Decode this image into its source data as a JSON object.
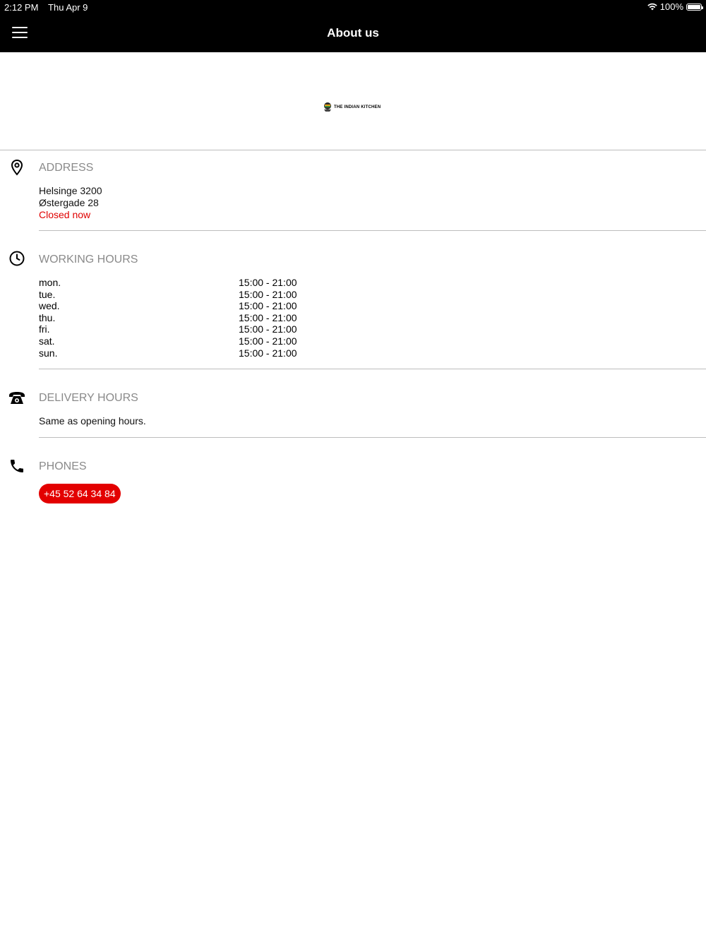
{
  "status_bar": {
    "time": "2:12 PM",
    "date": "Thu Apr 9",
    "battery": "100%"
  },
  "header": {
    "title": "About us"
  },
  "logo": {
    "text": "THE INDIAN KITCHEN"
  },
  "address": {
    "title": "ADDRESS",
    "line1": "Helsinge 3200",
    "line2": "Østergade 28",
    "status": "Closed now"
  },
  "working_hours": {
    "title": "WORKING HOURS",
    "days": [
      {
        "day": "mon.",
        "hours": "15:00 - 21:00"
      },
      {
        "day": "tue.",
        "hours": "15:00 - 21:00"
      },
      {
        "day": "wed.",
        "hours": "15:00 - 21:00"
      },
      {
        "day": "thu.",
        "hours": "15:00 - 21:00"
      },
      {
        "day": "fri.",
        "hours": "15:00 - 21:00"
      },
      {
        "day": "sat.",
        "hours": "15:00 - 21:00"
      },
      {
        "day": "sun.",
        "hours": "15:00 - 21:00"
      }
    ]
  },
  "delivery_hours": {
    "title": "DELIVERY HOURS",
    "text": "Same as opening hours."
  },
  "phones": {
    "title": "PHONES",
    "number": "+45 52 64 34 84"
  },
  "colors": {
    "accent": "#e30000",
    "header_bg": "#000000",
    "section_title": "#8a8a8a"
  }
}
